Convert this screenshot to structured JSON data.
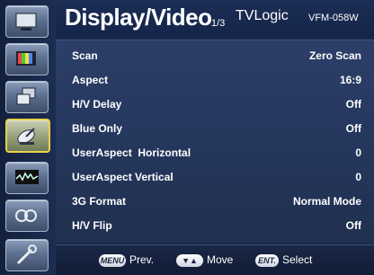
{
  "header": {
    "title": "Display/Video",
    "page": "1/3",
    "brand": "TVLogic",
    "model": "VFM-058W"
  },
  "sidebar": {
    "items": [
      {
        "icon": "monitor-icon",
        "active": false
      },
      {
        "icon": "color-bars-icon",
        "active": false
      },
      {
        "icon": "layers-icon",
        "active": false
      },
      {
        "icon": "satellite-dish-icon",
        "active": true
      },
      {
        "icon": "waveform-icon",
        "active": false
      },
      {
        "icon": "audio-icon",
        "active": false
      },
      {
        "icon": "tools-icon",
        "active": false
      }
    ]
  },
  "menu": {
    "rows": [
      {
        "label": "Scan",
        "value": "Zero Scan"
      },
      {
        "label": "Aspect",
        "value": "16:9"
      },
      {
        "label": "H/V Delay",
        "value": "Off"
      },
      {
        "label": "Blue Only",
        "value": "Off"
      },
      {
        "label": "UserAspect  Horizontal",
        "value": "0"
      },
      {
        "label": "UserAspect Vertical",
        "value": "0"
      },
      {
        "label": "3G Format",
        "value": "Normal Mode"
      },
      {
        "label": "H/V Flip",
        "value": "Off"
      }
    ]
  },
  "footer": {
    "menu_key": "MENU",
    "menu_hint": "Prev.",
    "arrows_key": "▼▲",
    "arrows_hint": "Move",
    "ent_key": "ENT.",
    "ent_hint": "Select"
  }
}
